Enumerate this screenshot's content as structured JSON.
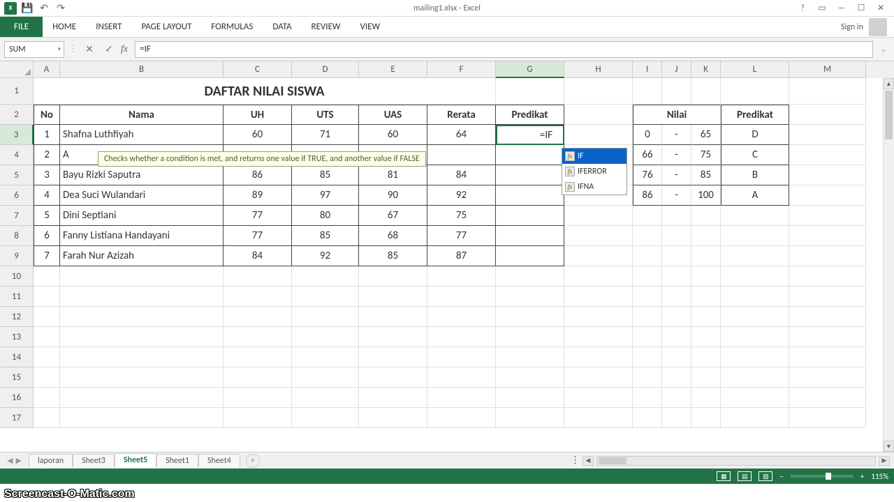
{
  "app": {
    "title": "mailing1.xlsx - Excel",
    "signin": "Sign in"
  },
  "ribbon": {
    "file": "FILE",
    "tabs": [
      "HOME",
      "INSERT",
      "PAGE LAYOUT",
      "FORMULAS",
      "DATA",
      "REVIEW",
      "VIEW"
    ]
  },
  "namebox": "SUM",
  "formula": "=IF",
  "columns": [
    "A",
    "B",
    "C",
    "D",
    "E",
    "F",
    "G",
    "H",
    "I",
    "J",
    "K",
    "L",
    "M"
  ],
  "rows": [
    "1",
    "2",
    "3",
    "4",
    "5",
    "6",
    "7",
    "8",
    "9",
    "10",
    "11",
    "12",
    "13",
    "14",
    "15",
    "16",
    "17"
  ],
  "title": "DAFTAR NILAI SISWA",
  "headers": {
    "no": "No",
    "nama": "Nama",
    "uh": "UH",
    "uts": "UTS",
    "uas": "UAS",
    "rerata": "Rerata",
    "predikat": "Predikat"
  },
  "lookup_headers": {
    "nilai": "Nilai",
    "predikat": "Predikat"
  },
  "editing_cell": "=IF",
  "partial_row2_a": "A",
  "students": [
    {
      "no": "1",
      "nama": "Shafna Luthfiyah",
      "uh": "60",
      "uts": "71",
      "uas": "60",
      "rerata": "64"
    },
    {
      "no": "2",
      "nama": "",
      "uh": "",
      "uts": "",
      "uas": "",
      "rerata": ""
    },
    {
      "no": "3",
      "nama": "Bayu Rizki Saputra",
      "uh": "86",
      "uts": "85",
      "uas": "81",
      "rerata": "84"
    },
    {
      "no": "4",
      "nama": "Dea Suci Wulandari",
      "uh": "89",
      "uts": "97",
      "uas": "90",
      "rerata": "92"
    },
    {
      "no": "5",
      "nama": "Dini Septiani",
      "uh": "77",
      "uts": "80",
      "uas": "67",
      "rerata": "75"
    },
    {
      "no": "6",
      "nama": "Fanny Listiana Handayani",
      "uh": "77",
      "uts": "85",
      "uas": "68",
      "rerata": "77"
    },
    {
      "no": "7",
      "nama": "Farah Nur Azizah",
      "uh": "84",
      "uts": "92",
      "uas": "85",
      "rerata": "87"
    }
  ],
  "lookup": [
    {
      "lo": "0",
      "dash": "-",
      "hi": "65",
      "grade": "D"
    },
    {
      "lo": "66",
      "dash": "-",
      "hi": "75",
      "grade": "C"
    },
    {
      "lo": "76",
      "dash": "-",
      "hi": "85",
      "grade": "B"
    },
    {
      "lo": "86",
      "dash": "-",
      "hi": "100",
      "grade": "A"
    }
  ],
  "tooltip": "Checks whether a condition is met, and returns one value if TRUE, and another value if FALSE",
  "autocomplete": [
    "IF",
    "IFERROR",
    "IFNA"
  ],
  "sheets": [
    "laporan",
    "Sheet3",
    "Sheet5",
    "Sheet1",
    "Sheet4"
  ],
  "active_sheet": 2,
  "zoom": "115%",
  "watermark": "Screencast-O-Matic.com"
}
